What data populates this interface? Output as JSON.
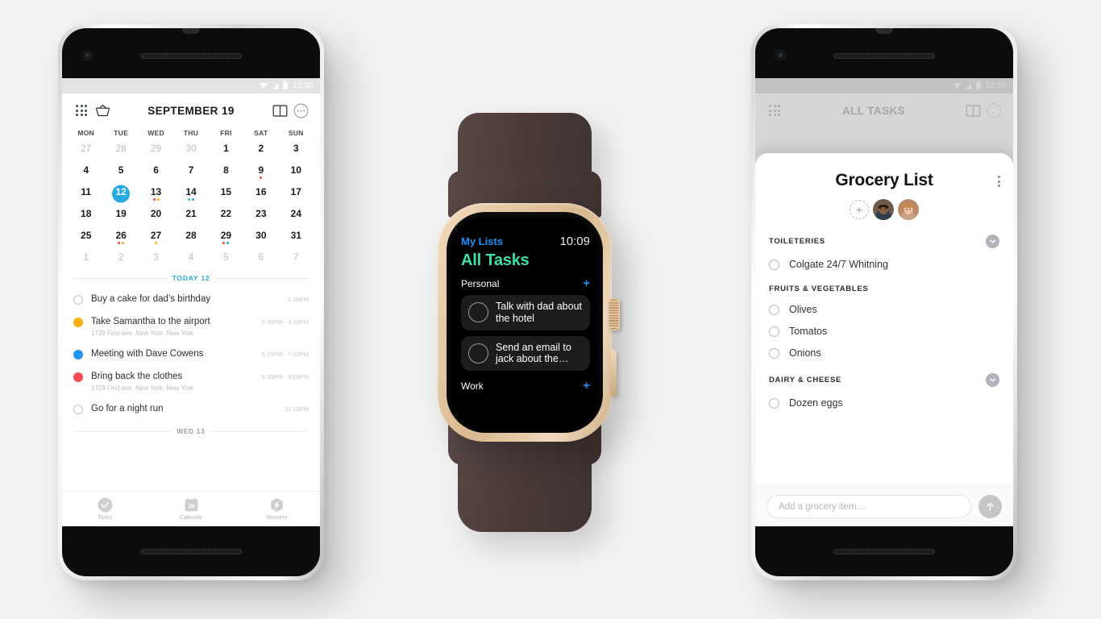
{
  "background_color": "#f2f2f2",
  "left_phone": {
    "status_bar": {
      "time": "12:30",
      "icons": [
        "wifi-triangle-icon",
        "signal-icon",
        "battery-icon"
      ]
    },
    "header": {
      "title": "SEPTEMBER 19",
      "icons": [
        "grid-menu-icon",
        "basket-icon",
        "book-view-icon",
        "more-circle-icon"
      ]
    },
    "calendar": {
      "weekdays": [
        "MON",
        "TUE",
        "WED",
        "THU",
        "FRI",
        "SAT",
        "SUN"
      ],
      "days": [
        {
          "n": "27",
          "muted": true,
          "dots": []
        },
        {
          "n": "28",
          "muted": true,
          "dots": []
        },
        {
          "n": "29",
          "muted": true,
          "dots": []
        },
        {
          "n": "30",
          "muted": true,
          "dots": []
        },
        {
          "n": "1",
          "muted": false,
          "dots": []
        },
        {
          "n": "2",
          "muted": false,
          "dots": []
        },
        {
          "n": "3",
          "muted": false,
          "dots": []
        },
        {
          "n": "4",
          "muted": false,
          "dots": []
        },
        {
          "n": "5",
          "muted": false,
          "dots": []
        },
        {
          "n": "6",
          "muted": false,
          "dots": []
        },
        {
          "n": "7",
          "muted": false,
          "dots": []
        },
        {
          "n": "8",
          "muted": false,
          "dots": []
        },
        {
          "n": "9",
          "muted": false,
          "dots": [
            "#f8423f"
          ]
        },
        {
          "n": "10",
          "muted": false,
          "dots": []
        },
        {
          "n": "11",
          "muted": false,
          "dots": []
        },
        {
          "n": "12",
          "muted": false,
          "today": true,
          "dots": []
        },
        {
          "n": "13",
          "muted": false,
          "dots": [
            "#f8423f",
            "#ffb114"
          ]
        },
        {
          "n": "14",
          "muted": false,
          "dots": [
            "#2ecc8f",
            "#25aae1"
          ]
        },
        {
          "n": "15",
          "muted": false,
          "dots": []
        },
        {
          "n": "16",
          "muted": false,
          "dots": []
        },
        {
          "n": "17",
          "muted": false,
          "dots": []
        },
        {
          "n": "18",
          "muted": false,
          "dots": []
        },
        {
          "n": "19",
          "muted": false,
          "dots": []
        },
        {
          "n": "20",
          "muted": false,
          "dots": []
        },
        {
          "n": "21",
          "muted": false,
          "dots": []
        },
        {
          "n": "22",
          "muted": false,
          "dots": []
        },
        {
          "n": "23",
          "muted": false,
          "dots": []
        },
        {
          "n": "24",
          "muted": false,
          "dots": []
        },
        {
          "n": "25",
          "muted": false,
          "dots": []
        },
        {
          "n": "26",
          "muted": false,
          "dots": [
            "#f8423f",
            "#ffb114"
          ]
        },
        {
          "n": "27",
          "muted": false,
          "dots": [
            "#ffb114"
          ]
        },
        {
          "n": "28",
          "muted": false,
          "dots": []
        },
        {
          "n": "29",
          "muted": false,
          "dots": [
            "#f8423f",
            "#25aae1"
          ]
        },
        {
          "n": "30",
          "muted": false,
          "dots": []
        },
        {
          "n": "31",
          "muted": false,
          "dots": []
        },
        {
          "n": "1",
          "muted": true,
          "dots": []
        },
        {
          "n": "2",
          "muted": true,
          "dots": []
        },
        {
          "n": "3",
          "muted": true,
          "dots": []
        },
        {
          "n": "4",
          "muted": true,
          "dots": []
        },
        {
          "n": "5",
          "muted": true,
          "dots": []
        },
        {
          "n": "6",
          "muted": true,
          "dots": []
        },
        {
          "n": "7",
          "muted": true,
          "dots": []
        }
      ],
      "today_label": "TODAY 12",
      "next_day_label": "WED 13",
      "today_accent": "#25aae1"
    },
    "tasks": [
      {
        "title": "Buy a cake for dad’s birthday",
        "subtitle": "",
        "time": "1:30PM",
        "mark": "ring",
        "color": ""
      },
      {
        "title": "Take Samantha to the airport",
        "subtitle": "1729 First ave, New York, New York",
        "time": "2:30PM - 3:30PM",
        "mark": "dot",
        "color": "#ffb114"
      },
      {
        "title": "Meeting with Dave Cowens",
        "subtitle": "",
        "time": "6:25PM - 7:30PM",
        "mark": "dot",
        "color": "#2196f3"
      },
      {
        "title": "Bring back the clothes",
        "subtitle": "1729 First ave, New York, New York",
        "time": "8:30PM - 9:00PM",
        "mark": "dot",
        "color": "#fa4a55"
      },
      {
        "title": "Go for a night run",
        "subtitle": "",
        "time": "11:30PM",
        "mark": "ring",
        "color": ""
      }
    ],
    "tabbar": [
      {
        "label": "Tasks",
        "icon": "check-circle-icon"
      },
      {
        "label": "Calendar",
        "icon": "calendar-26-icon"
      },
      {
        "label": "Moment",
        "icon": "bolt-icon"
      }
    ]
  },
  "watch": {
    "nav_back": "My Lists",
    "time": "10:09",
    "screen_title": "All Tasks",
    "accent_blue": "#1e8fff",
    "accent_green": "#3ce0a8",
    "sections": [
      {
        "name": "Personal",
        "add_label": "+",
        "items": [
          "Talk with dad about the hotel",
          "Send an email to jack about the…"
        ]
      },
      {
        "name": "Work",
        "add_label": "+",
        "items": []
      }
    ]
  },
  "right_phone": {
    "status_bar": {
      "time": "12:30"
    },
    "background_header_title": "ALL TASKS",
    "sheet": {
      "title": "Grocery List",
      "menu_icon": "kebab-menu-icon",
      "add_member_label": "+",
      "members": [
        "member-avatar-1",
        "member-avatar-2"
      ],
      "sections": [
        {
          "name": "TOILETERIES",
          "collapsible": true,
          "items": [
            "Colgate 24/7 Whitning"
          ]
        },
        {
          "name": "FRUITS & VEGETABLES",
          "collapsible": false,
          "items": [
            "Olives",
            "Tomatos",
            "Onions"
          ]
        },
        {
          "name": "DAIRY & CHEESE",
          "collapsible": true,
          "items": [
            "Dozen eggs"
          ]
        }
      ],
      "composer": {
        "placeholder": "Add a grocery item…",
        "value": "",
        "send_icon": "arrow-up-icon"
      }
    }
  }
}
